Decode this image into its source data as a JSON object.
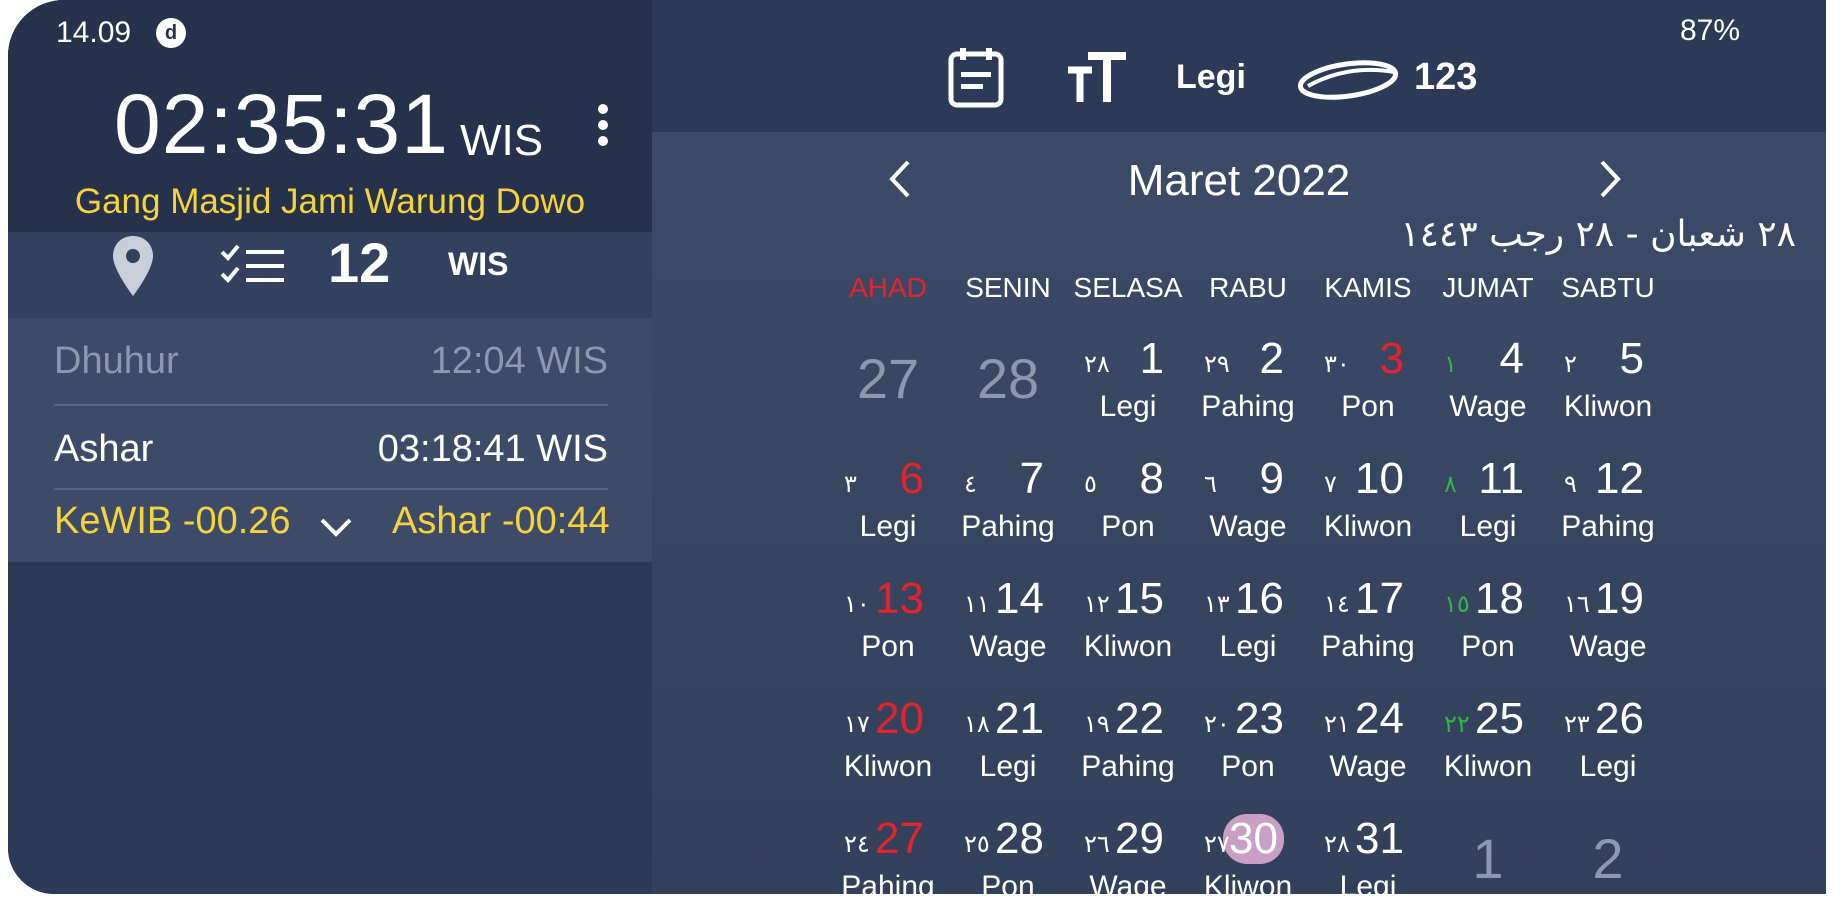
{
  "status": {
    "time": "14.09",
    "battery": "87%"
  },
  "clock": {
    "time": "02:35:31",
    "zone": "WIS"
  },
  "location": "Gang Masjid Jami Warung Dowo",
  "info": {
    "count": "12",
    "zone": "WIS"
  },
  "prayers": {
    "previous": {
      "name": "Dhuhur",
      "time": "12:04 WIS"
    },
    "next": {
      "name": "Ashar",
      "time": "03:18:41 WIS"
    },
    "countdown_left": "KeWIB -00.26",
    "countdown_right": "Ashar -00:44"
  },
  "toolbar": {
    "pasaran_label": "Legi",
    "number_label": "123"
  },
  "calendar": {
    "month_title": "Maret 2022",
    "hijri_range": "٢٨ شعبان - ٢٨ رجب ١٤٤٣",
    "day_headers": [
      "AHAD",
      "SENIN",
      "SELASA",
      "RABU",
      "KAMIS",
      "JUMAT",
      "SABTU"
    ],
    "weeks": [
      [
        {
          "g": "27",
          "other": true
        },
        {
          "g": "28",
          "other": true
        },
        {
          "g": "1",
          "h": "٢٨",
          "p": "Legi"
        },
        {
          "g": "2",
          "h": "٢٩",
          "p": "Pahing"
        },
        {
          "g": "3",
          "h": "٣٠",
          "p": "Pon",
          "red": true
        },
        {
          "g": "4",
          "h": "١",
          "p": "Wage",
          "hg": true
        },
        {
          "g": "5",
          "h": "٢",
          "p": "Kliwon"
        }
      ],
      [
        {
          "g": "6",
          "h": "٣",
          "p": "Legi",
          "red": true
        },
        {
          "g": "7",
          "h": "٤",
          "p": "Pahing"
        },
        {
          "g": "8",
          "h": "٥",
          "p": "Pon"
        },
        {
          "g": "9",
          "h": "٦",
          "p": "Wage"
        },
        {
          "g": "10",
          "h": "٧",
          "p": "Kliwon"
        },
        {
          "g": "11",
          "h": "٨",
          "p": "Legi",
          "hg": true
        },
        {
          "g": "12",
          "h": "٩",
          "p": "Pahing"
        }
      ],
      [
        {
          "g": "13",
          "h": "١٠",
          "p": "Pon",
          "red": true
        },
        {
          "g": "14",
          "h": "١١",
          "p": "Wage"
        },
        {
          "g": "15",
          "h": "١٢",
          "p": "Kliwon"
        },
        {
          "g": "16",
          "h": "١٣",
          "p": "Legi"
        },
        {
          "g": "17",
          "h": "١٤",
          "p": "Pahing"
        },
        {
          "g": "18",
          "h": "١٥",
          "p": "Pon",
          "hg": true
        },
        {
          "g": "19",
          "h": "١٦",
          "p": "Wage"
        }
      ],
      [
        {
          "g": "20",
          "h": "١٧",
          "p": "Kliwon",
          "red": true
        },
        {
          "g": "21",
          "h": "١٨",
          "p": "Legi"
        },
        {
          "g": "22",
          "h": "١٩",
          "p": "Pahing"
        },
        {
          "g": "23",
          "h": "٢٠",
          "p": "Pon"
        },
        {
          "g": "24",
          "h": "٢١",
          "p": "Wage"
        },
        {
          "g": "25",
          "h": "٢٢",
          "p": "Kliwon",
          "hg": true
        },
        {
          "g": "26",
          "h": "٢٣",
          "p": "Legi"
        }
      ],
      [
        {
          "g": "27",
          "h": "٢٤",
          "p": "Pahing",
          "red": true
        },
        {
          "g": "28",
          "h": "٢٥",
          "p": "Pon"
        },
        {
          "g": "29",
          "h": "٢٦",
          "p": "Wage"
        },
        {
          "g": "30",
          "h": "٢٧",
          "p": "Kliwon",
          "today": true
        },
        {
          "g": "31",
          "h": "٢٨",
          "p": "Legi"
        },
        {
          "g": "1",
          "other": true
        },
        {
          "g": "2",
          "other": true
        }
      ]
    ]
  },
  "colors": {
    "accent_yellow": "#f5d33b",
    "sunday_red": "#e3242b",
    "hijri_green": "#2fb54a",
    "today_pink": "#c9a0c4"
  },
  "icons": [
    "status-notification-icon",
    "menu-icon",
    "location-pin-icon",
    "checklist-icon",
    "chevron-down-icon",
    "note-icon",
    "font-size-icon",
    "hijri-crescent-icon",
    "chevron-left-icon",
    "chevron-right-icon"
  ]
}
